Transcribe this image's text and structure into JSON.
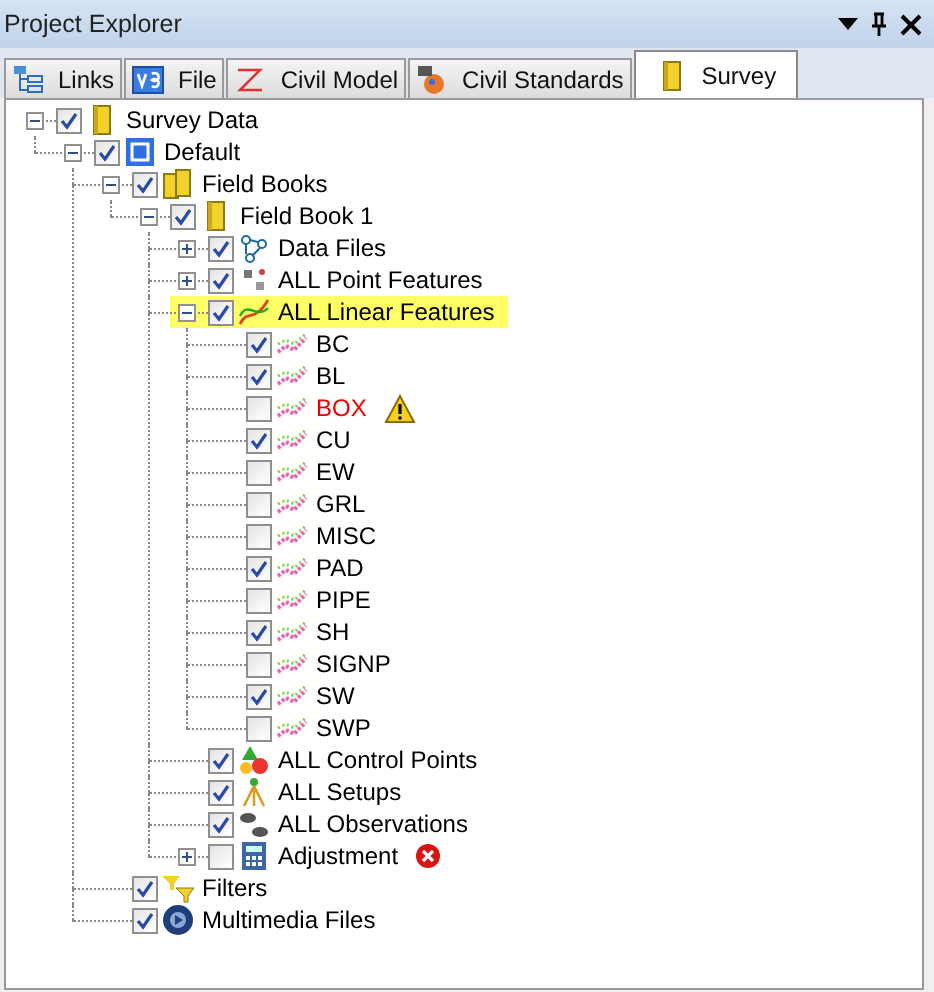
{
  "window": {
    "title": "Project Explorer"
  },
  "tabs": [
    {
      "label": "Links",
      "kind": "links",
      "selected": false
    },
    {
      "label": "File",
      "kind": "file",
      "selected": false
    },
    {
      "label": "Civil Model",
      "kind": "civil",
      "selected": false
    },
    {
      "label": "Civil Standards",
      "kind": "standards",
      "selected": false
    },
    {
      "label": "Survey",
      "kind": "book",
      "selected": true
    }
  ],
  "tree": [
    {
      "label": "Survey Data",
      "kind": "book",
      "checked": true,
      "expanded": true,
      "children": [
        {
          "label": "Default",
          "kind": "default",
          "checked": true,
          "expanded": true,
          "children": [
            {
              "label": "Field Books",
              "kind": "books",
              "checked": true,
              "expanded": true,
              "children": [
                {
                  "label": "Field Book 1",
                  "kind": "book",
                  "checked": true,
                  "expanded": true,
                  "children": [
                    {
                      "label": "Data Files",
                      "kind": "datafiles",
                      "checked": true,
                      "expanded": false
                    },
                    {
                      "label": "ALL Point Features",
                      "kind": "points",
                      "checked": true,
                      "expanded": false
                    },
                    {
                      "label": "ALL Linear Features",
                      "kind": "linear",
                      "checked": true,
                      "expanded": true,
                      "highlighted": true,
                      "children": [
                        {
                          "label": "BC",
                          "kind": "feature",
                          "checked": true
                        },
                        {
                          "label": "BL",
                          "kind": "feature",
                          "checked": true
                        },
                        {
                          "label": "BOX",
                          "kind": "feature",
                          "checked": false,
                          "warning": true
                        },
                        {
                          "label": "CU",
                          "kind": "feature",
                          "checked": true
                        },
                        {
                          "label": "EW",
                          "kind": "feature",
                          "checked": false
                        },
                        {
                          "label": "GRL",
                          "kind": "feature",
                          "checked": false
                        },
                        {
                          "label": "MISC",
                          "kind": "feature",
                          "checked": false
                        },
                        {
                          "label": "PAD",
                          "kind": "feature",
                          "checked": true
                        },
                        {
                          "label": "PIPE",
                          "kind": "feature",
                          "checked": false
                        },
                        {
                          "label": "SH",
                          "kind": "feature",
                          "checked": true
                        },
                        {
                          "label": "SIGNP",
                          "kind": "feature",
                          "checked": false
                        },
                        {
                          "label": "SW",
                          "kind": "feature",
                          "checked": true
                        },
                        {
                          "label": "SWP",
                          "kind": "feature",
                          "checked": false
                        }
                      ]
                    },
                    {
                      "label": "ALL Control Points",
                      "kind": "control",
                      "checked": true
                    },
                    {
                      "label": "ALL Setups",
                      "kind": "setups",
                      "checked": true
                    },
                    {
                      "label": "ALL Observations",
                      "kind": "observations",
                      "checked": true
                    },
                    {
                      "label": "Adjustment",
                      "kind": "calculator",
                      "checked": false,
                      "expanded": false,
                      "error": true
                    }
                  ]
                }
              ]
            },
            {
              "label": "Filters",
              "kind": "filter",
              "checked": true
            },
            {
              "label": "Multimedia Files",
              "kind": "media",
              "checked": true
            }
          ]
        }
      ]
    }
  ]
}
